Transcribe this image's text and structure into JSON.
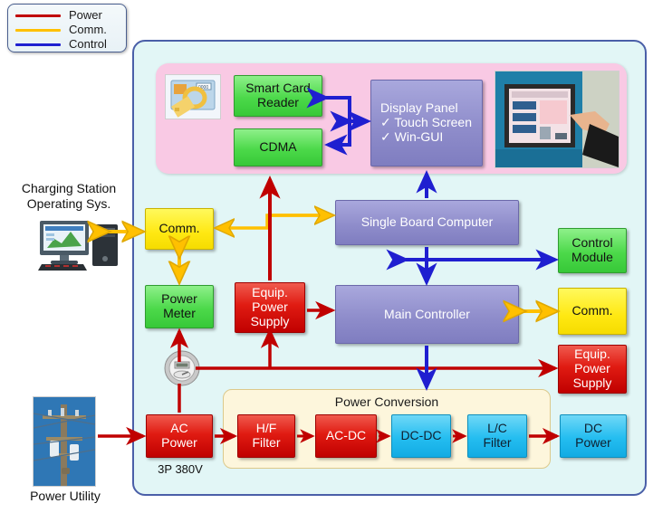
{
  "legend": {
    "items": [
      {
        "label": "Power",
        "color": "#c00000",
        "icon": "power-line-swatch"
      },
      {
        "label": "Comm.",
        "color": "#ffc000",
        "icon": "comm-line-swatch"
      },
      {
        "label": "Control",
        "color": "#1f1fd0",
        "icon": "control-line-swatch"
      }
    ]
  },
  "external": {
    "operating_system_label_line1": "Charging Station",
    "operating_system_label_line2": "Operating Sys.",
    "operating_system_icon": "desktop-computer-icon",
    "power_utility_label": "Power Utility",
    "power_utility_icon": "utility-pole-photo",
    "meter_icon": "electric-meter-icon"
  },
  "hmi_panel": {
    "smart_card_icon": "smart-card-key-icon",
    "smart_card_reader": "Smart Card\nReader",
    "smart_card_reader_line1": "Smart Card",
    "smart_card_reader_line2": "Reader",
    "cdma": "CDMA",
    "display_panel_title": "Display Panel",
    "display_panel_feature1": "✓ Touch Screen",
    "display_panel_feature2": "✓ Win-GUI",
    "kiosk_photo": "touchscreen-kiosk-photo"
  },
  "nodes": {
    "comm_left": "Comm.",
    "power_meter_line1": "Power",
    "power_meter_line2": "Meter",
    "equip_power_supply_line1": "Equip.",
    "equip_power_supply_line2": "Power",
    "equip_power_supply_line3": "Supply",
    "single_board_computer": "Single Board Computer",
    "main_controller": "Main Controller",
    "control_module_line1": "Control",
    "control_module_line2": "Module",
    "comm_right": "Comm.",
    "equip_power_supply_right_line1": "Equip.",
    "equip_power_supply_right_line2": "Power",
    "equip_power_supply_right_line3": "Supply",
    "ac_power_line1": "AC",
    "ac_power_line2": "Power",
    "ac_power_spec": "3P 380V",
    "dc_power_line1": "DC",
    "dc_power_line2": "Power"
  },
  "power_conversion": {
    "title": "Power Conversion",
    "stages": [
      {
        "line1": "H/F",
        "line2": "Filter",
        "color": "red"
      },
      {
        "line1": "AC-DC",
        "line2": "",
        "color": "red"
      },
      {
        "line1": "DC-DC",
        "line2": "",
        "color": "cyan"
      },
      {
        "line1": "L/C",
        "line2": "Filter",
        "color": "cyan"
      }
    ]
  },
  "colors": {
    "power": "#c00000",
    "comm": "#ffc000",
    "control": "#1f1fd0",
    "station_bg": "#e2f6f6",
    "station_border": "#4a5fa8",
    "hmi_bg": "#f9c9e4",
    "conversion_bg": "#fdf6dc"
  }
}
